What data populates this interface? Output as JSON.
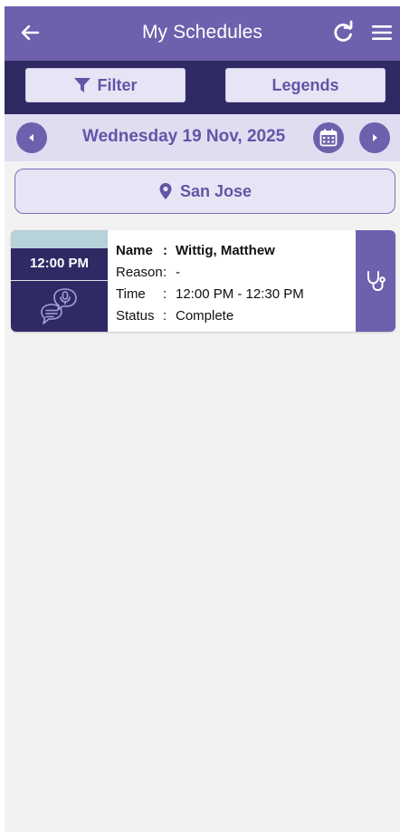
{
  "header": {
    "title": "My Schedules",
    "back_icon": "back-arrow-icon",
    "refresh_icon": "refresh-icon",
    "menu_icon": "hamburger-menu-icon"
  },
  "toolbar": {
    "filter_label": "Filter",
    "legends_label": "Legends"
  },
  "date_nav": {
    "date": "Wednesday 19 Nov, 2025"
  },
  "location": {
    "name": "San Jose"
  },
  "appointments": [
    {
      "time": "12:00 PM",
      "name_key": "Name",
      "name": "Wittig, Matthew",
      "reason_key": "Reason",
      "reason": "-",
      "time_key": "Time",
      "time_range": "12:00 PM - 12:30 PM",
      "status_key": "Status",
      "status": "Complete",
      "separator": ":"
    }
  ],
  "colors": {
    "header": "#6e60ad",
    "filter_bar": "#2f2a64",
    "date_bar": "#e0ddf1",
    "accent": "#6255a7"
  }
}
